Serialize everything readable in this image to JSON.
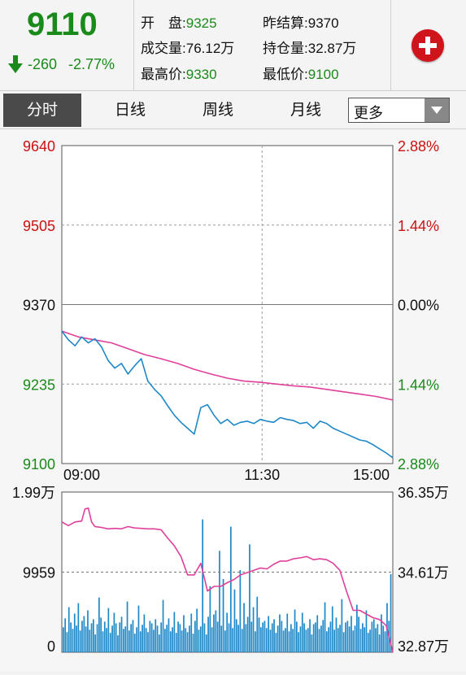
{
  "header": {
    "last_price": "9110",
    "change_abs": "-260",
    "change_pct": "-2.77%",
    "stats": {
      "open_label": "开　盘:",
      "open_value": "9325",
      "prev_settle_label": "昨结算:",
      "prev_settle_value": "9370",
      "volume_label": "成交量:",
      "volume_value": "76.12万",
      "open_interest_label": "持仓量:",
      "open_interest_value": "32.87万",
      "high_label": "最高价:",
      "high_value": "9330",
      "low_label": "最低价:",
      "low_value": "9100"
    }
  },
  "tabs": [
    "分时",
    "日线",
    "周线",
    "月线"
  ],
  "more_select": "更多",
  "colors": {
    "up": "#cc1111",
    "down": "#1a8a1a",
    "price_line": "#1e88c8",
    "avg_line": "#e0409a",
    "volume_bar": "#1e88c8"
  },
  "chart_data": [
    {
      "type": "line",
      "title": "",
      "y_left_ticks": [
        "9640",
        "9505",
        "9370",
        "9235",
        "9100"
      ],
      "y_right_ticks": [
        "2.88%",
        "1.44%",
        "0.00%",
        "1.44%",
        "2.88%"
      ],
      "x_ticks": [
        "09:00",
        "11:30",
        "15:00"
      ],
      "ylim": [
        9100,
        9640
      ],
      "reference_value": 9370,
      "series": [
        {
          "key": "price",
          "x": [
            0,
            2,
            4,
            6,
            8,
            10,
            12,
            14,
            16,
            18,
            20,
            22,
            24,
            26,
            28,
            30,
            32,
            34,
            36,
            38,
            40,
            42,
            44,
            46,
            48,
            50,
            52,
            54,
            56,
            58,
            60,
            62,
            64,
            66,
            68,
            70,
            72,
            74,
            76,
            78,
            80,
            82,
            84,
            86,
            88,
            90,
            92,
            94,
            96,
            98,
            100
          ],
          "values": [
            9325,
            9310,
            9300,
            9315,
            9305,
            9312,
            9298,
            9275,
            9262,
            9270,
            9252,
            9266,
            9278,
            9240,
            9226,
            9215,
            9198,
            9182,
            9170,
            9160,
            9150,
            9195,
            9200,
            9182,
            9168,
            9175,
            9165,
            9170,
            9172,
            9168,
            9175,
            9172,
            9170,
            9178,
            9175,
            9173,
            9168,
            9170,
            9160,
            9172,
            9168,
            9160,
            9155,
            9150,
            9145,
            9140,
            9138,
            9132,
            9125,
            9118,
            9110
          ]
        },
        {
          "key": "average",
          "x": [
            0,
            5,
            10,
            15,
            20,
            25,
            30,
            35,
            40,
            45,
            50,
            55,
            60,
            65,
            70,
            75,
            80,
            85,
            90,
            95,
            100
          ],
          "values": [
            9325,
            9315,
            9310,
            9305,
            9295,
            9285,
            9278,
            9270,
            9260,
            9252,
            9245,
            9240,
            9238,
            9235,
            9232,
            9230,
            9226,
            9222,
            9218,
            9214,
            9208
          ]
        }
      ]
    },
    {
      "type": "bar",
      "y_left_ticks": [
        "1.99万",
        "9959",
        "0"
      ],
      "y_right_ticks": [
        "36.35万",
        "34.61万",
        "32.87万"
      ],
      "ylim_volume": [
        0,
        19900
      ],
      "open_interest_range": [
        "32.87万",
        "36.35万"
      ],
      "series": [
        {
          "key": "open_interest",
          "x": [
            0,
            2,
            4,
            6,
            7,
            8,
            9,
            10,
            12,
            14,
            16,
            18,
            20,
            22,
            24,
            26,
            28,
            30,
            32,
            34,
            36,
            38,
            40,
            42,
            44,
            46,
            48,
            50,
            52,
            54,
            56,
            58,
            60,
            62,
            64,
            66,
            68,
            70,
            72,
            74,
            76,
            78,
            80,
            82,
            84,
            86,
            88,
            90,
            92,
            94,
            96,
            98,
            100
          ],
          "values": [
            35.7,
            35.62,
            35.7,
            35.72,
            35.98,
            36.0,
            35.7,
            35.6,
            35.58,
            35.55,
            35.56,
            35.55,
            35.6,
            35.57,
            35.56,
            35.55,
            35.55,
            35.53,
            35.35,
            35.18,
            34.95,
            34.55,
            34.55,
            34.8,
            34.2,
            34.3,
            34.3,
            34.38,
            34.45,
            34.55,
            34.6,
            34.65,
            34.7,
            34.68,
            34.78,
            34.85,
            34.85,
            34.9,
            34.92,
            34.95,
            34.88,
            34.9,
            34.88,
            34.8,
            34.65,
            34.2,
            33.78,
            33.78,
            33.7,
            33.62,
            33.58,
            33.45,
            32.87
          ]
        },
        {
          "key": "volume",
          "values": [
            3100,
            4200,
            2500,
            5600,
            3700,
            2900,
            4800,
            3300,
            6100,
            2700,
            3900,
            4500,
            3200,
            5200,
            2800,
            3600,
            4100,
            2200,
            3500,
            6800,
            4300,
            2600,
            3800,
            3000,
            5500,
            2400,
            3300,
            4900,
            3600,
            2100,
            3700,
            4400,
            2900,
            3200,
            6300,
            2700,
            3500,
            4000,
            2300,
            3100,
            5800,
            2600,
            3400,
            4700,
            3000,
            2500,
            3900,
            3600,
            2800,
            4100,
            3300,
            2200,
            3700,
            6500,
            2900,
            3400,
            4200,
            2600,
            3100,
            5000,
            2400,
            3800,
            3500,
            2700,
            4600,
            3000,
            2500,
            3300,
            4800,
            2300,
            3900,
            5400,
            2800,
            3200,
            16500,
            3600,
            2200,
            4400,
            8200,
            3100,
            4700,
            5200,
            3800,
            12600,
            3300,
            9100,
            2700,
            4900,
            3600,
            15600,
            3000,
            7800,
            4100,
            3400,
            10200,
            2900,
            6100,
            3500,
            4400,
            13400,
            3800,
            5600,
            2600,
            6900,
            4300,
            3100,
            3700,
            3900,
            3000,
            4500,
            2800,
            3600,
            4100,
            2400,
            3300,
            4700,
            3900,
            2700,
            3000,
            4800,
            2600,
            3500,
            2900,
            5300,
            3800,
            2500,
            3200,
            4900,
            3600,
            2800,
            3000,
            4100,
            2200,
            3500,
            3700,
            4600,
            2900,
            3300,
            4000,
            6200,
            2600,
            3100,
            3800,
            5700,
            2800,
            4300,
            3000,
            3400,
            6600,
            2500,
            3700,
            3900,
            3200,
            4500,
            2700,
            3300,
            5900,
            4400,
            2900,
            3600,
            3100,
            5200,
            2400,
            2800,
            3800,
            4100,
            3000,
            3500,
            2200,
            4700,
            3300,
            2600,
            6100,
            3900,
            9700
          ]
        }
      ]
    }
  ]
}
